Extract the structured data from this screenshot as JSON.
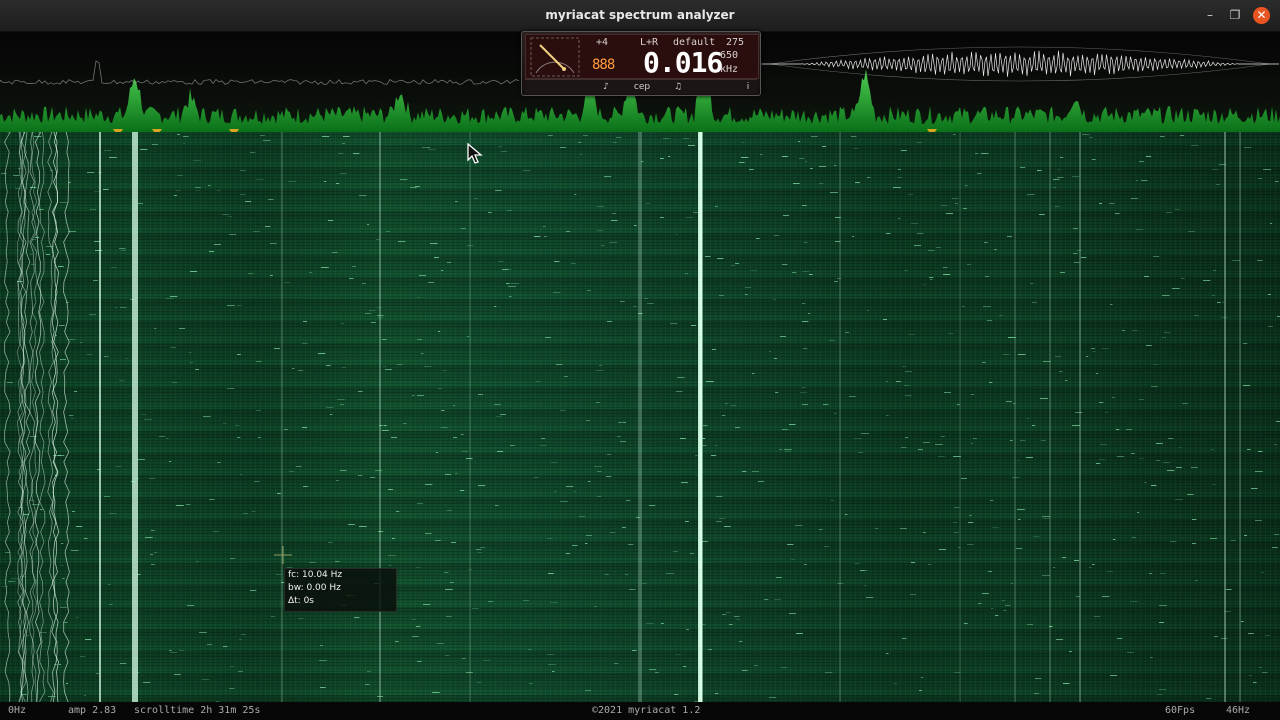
{
  "window": {
    "title": "myriacat spectrum analyzer",
    "minimize": "–",
    "maximize": "❐",
    "close": "✕"
  },
  "panel": {
    "plus": "+4",
    "channel": "L+R",
    "preset": "default",
    "preset_num": "275",
    "small_digits": "888",
    "readout": "0.016",
    "readout_sub": "650",
    "readout_unit": "kHz",
    "tabs": {
      "note1": "♪",
      "cep": "cep",
      "note2": "♫",
      "info": "i"
    }
  },
  "cursor_info": {
    "fc": "fc: 10.04 Hz",
    "bw": "bw: 0.00 Hz",
    "dt": "Δt: 0s"
  },
  "status": {
    "left_freq": "0Hz",
    "amp": "amp 2.83",
    "scrolltime": "scrolltime 2h 31m 25s",
    "copyright": "©2021 myriacat 1.2",
    "fps": "60Fps",
    "right_freq": "46Hz"
  },
  "colors": {
    "accent": "#00ff3c",
    "close": "#e95420",
    "peak_marker": "#d9a520"
  },
  "icons": {
    "minimize": "minimize-icon",
    "maximize": "maximize-icon",
    "close": "close-icon",
    "dial": "needle-dial-icon",
    "pointer": "mouse-pointer-icon"
  }
}
